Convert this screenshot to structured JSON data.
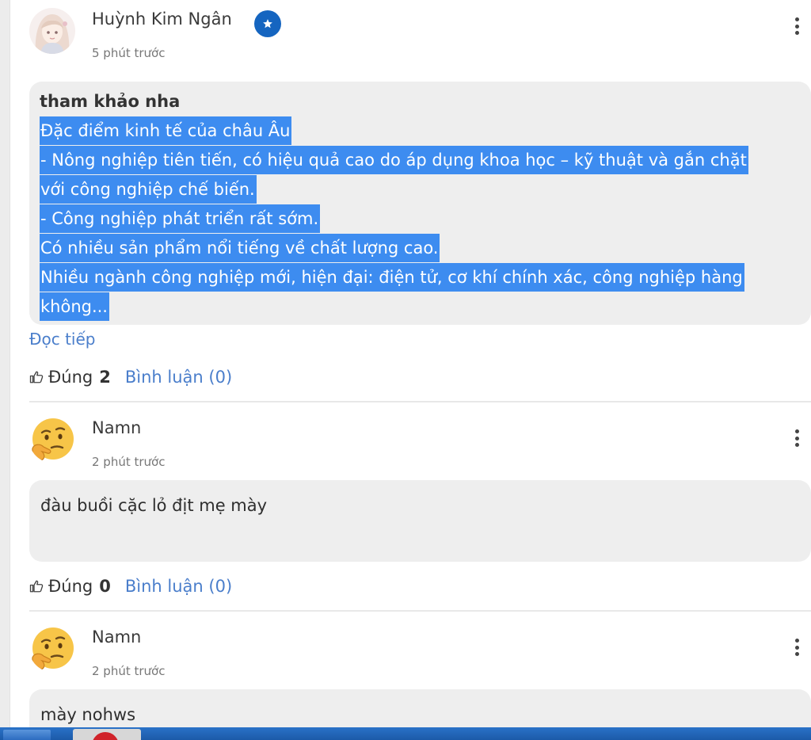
{
  "posts": [
    {
      "author": "Huỳnh Kim Ngân",
      "time": "5 phút trước",
      "heading": "tham khảo nha",
      "lines": [
        "Đặc điểm kinh tế của châu Âu",
        "- Nông nghiệp tiên tiến, có hiệu quả cao do áp dụng khoa học – kỹ thuật và gắn chặt",
        "với công nghiệp chế biến.",
        "- Công nghiệp phát triển rất sớm.",
        "Có nhiều sản phẩm nổi tiếng về chất lượng cao.",
        "Nhiều ngành công nghiệp mới, hiện đại: điện tử, cơ khí chính xác, công nghiệp hàng",
        "không..."
      ],
      "read_more": "Đọc tiếp",
      "like_label": "Đúng",
      "like_count": "2",
      "comments_label": "Bình luận (0)"
    },
    {
      "author": "Namn",
      "time": "2 phút trước",
      "text": "đàu buồi cặc lỏ địt mẹ mày",
      "like_label": "Đúng",
      "like_count": "0",
      "comments_label": "Bình luận (0)"
    },
    {
      "author": "Namn",
      "time": "2 phút trước",
      "text": "mày nohws"
    }
  ],
  "colors": {
    "highlight": "#3d8cf0",
    "link": "#4a7ecb",
    "badge": "#1565c0",
    "bubble": "#eeeeee"
  }
}
